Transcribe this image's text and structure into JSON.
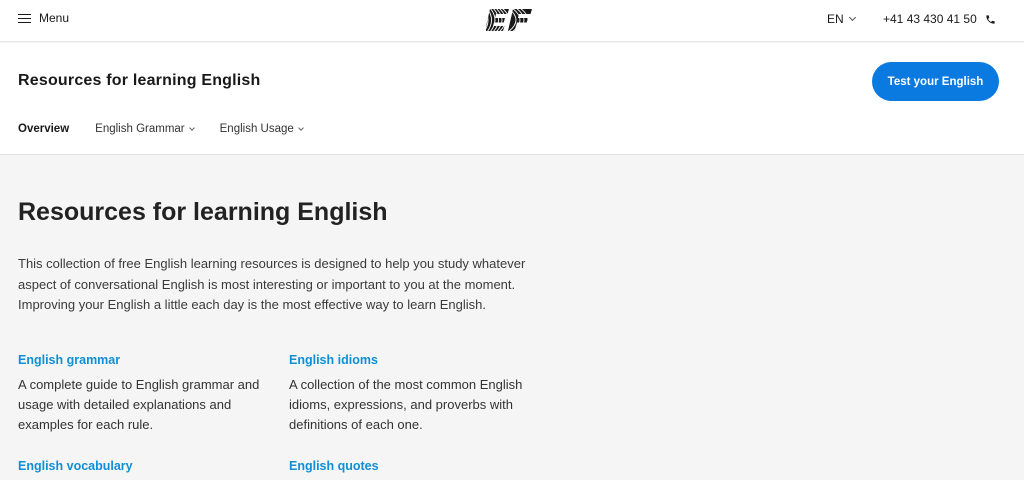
{
  "topbar": {
    "menu_label": "Menu",
    "logo_text": "EF",
    "language": "EN",
    "phone": "+41 43 430 41 50"
  },
  "subheader": {
    "title": "Resources for learning English",
    "cta_label": "Test your English",
    "tabs": [
      {
        "label": "Overview",
        "active": true
      },
      {
        "label": "English Grammar",
        "dropdown": true
      },
      {
        "label": "English Usage",
        "dropdown": true
      }
    ]
  },
  "main": {
    "heading": "Resources for learning English",
    "intro": "This collection of free English learning resources is designed to help you study whatever aspect of conversational English is most interesting or important to you at the moment. Improving your English a little each day is the most effective way to learn English.",
    "cards": [
      {
        "title": "English grammar",
        "desc": "A complete guide to English grammar and usage with detailed explanations and examples for each rule."
      },
      {
        "title": "English idioms",
        "desc": "A collection of the most common English idioms, expressions, and proverbs with definitions of each one."
      },
      {
        "title": "English vocabulary",
        "desc": ""
      },
      {
        "title": "English quotes",
        "desc": ""
      }
    ]
  },
  "colors": {
    "accent": "#0a7ae0",
    "link": "#0f8fd6"
  }
}
